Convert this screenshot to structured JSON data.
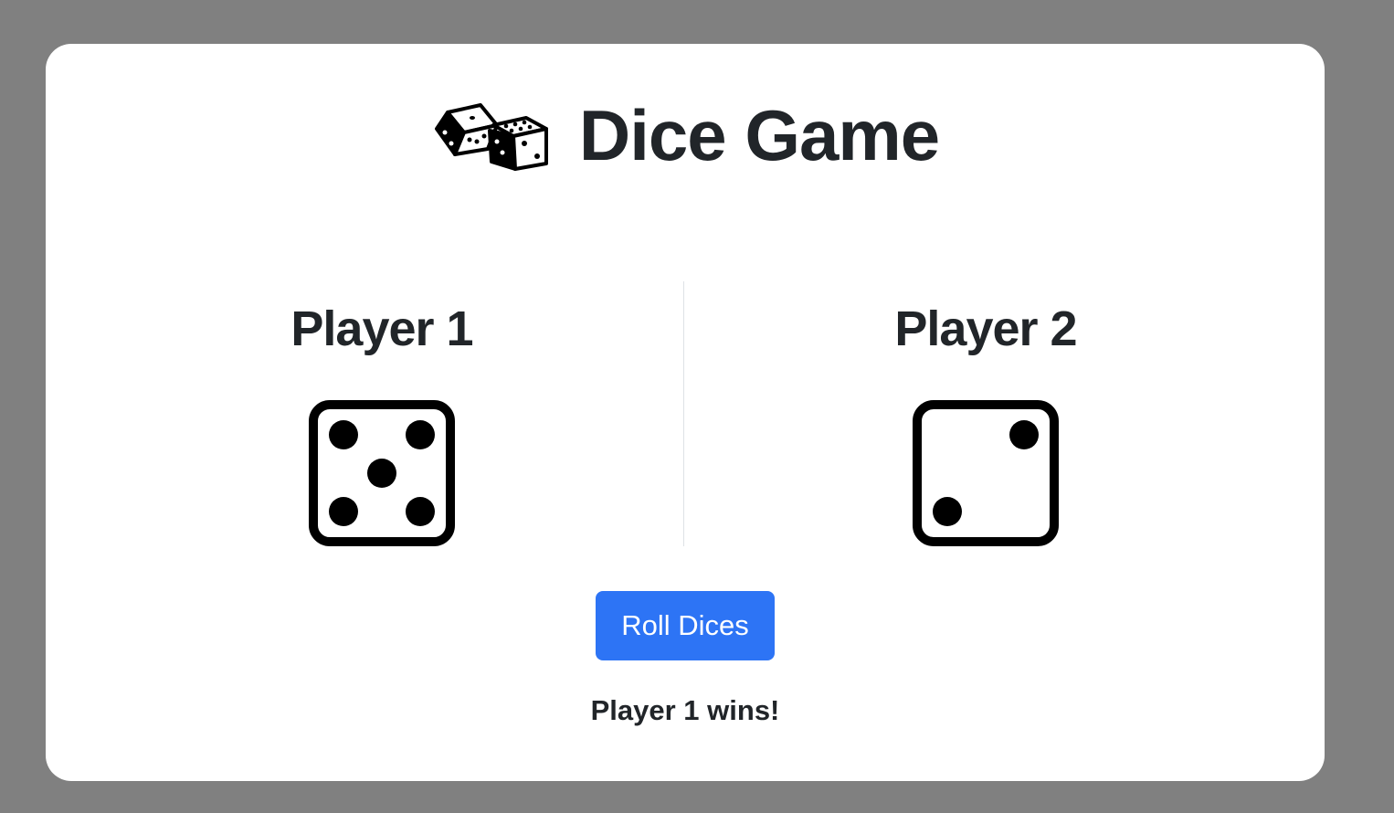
{
  "header": {
    "title": "Dice Game",
    "icon": "dice-pair-icon"
  },
  "players": [
    {
      "name": "Player 1",
      "die_value": 5,
      "die_icon": "die-face-5-icon"
    },
    {
      "name": "Player 2",
      "die_value": 2,
      "die_icon": "die-face-2-icon"
    }
  ],
  "controls": {
    "roll_label": "Roll Dices",
    "button_color": "#2d74f5"
  },
  "result": {
    "message": "Player 1 wins!"
  }
}
